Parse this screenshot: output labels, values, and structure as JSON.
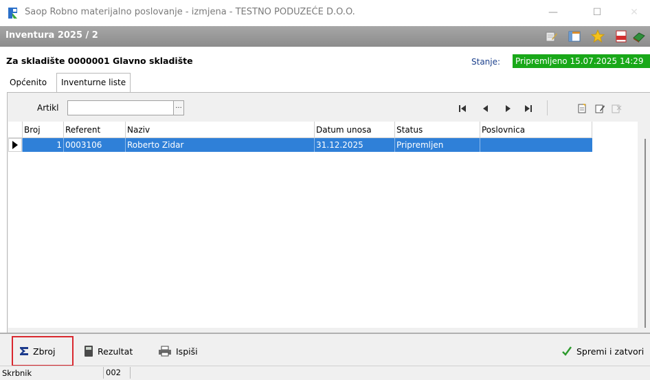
{
  "window": {
    "title": "Saop Robno materijalno poslovanje - izmjena  - TESTNO PODUZEĆE D.O.O.",
    "minimize_glyph": "—",
    "maximize_glyph": "☐",
    "close_glyph": "✕"
  },
  "form": {
    "title": "Inventura 2025 / 2",
    "warehouse": "Za skladište  0000001 Glavno skladište",
    "state_label": "Stanje:",
    "state_value": "Pripremljeno 15.07.2025 14:29"
  },
  "tabs": [
    {
      "label": "Općenito"
    },
    {
      "label": "Inventurne liste"
    }
  ],
  "toolbar": {
    "article_label": "Artikl",
    "article_value": "",
    "lookup_glyph": "..."
  },
  "grid": {
    "columns": [
      "Broj",
      "Referent",
      "Naziv",
      "Datum unosa",
      "Status",
      "Poslovnica"
    ],
    "rows": [
      {
        "broj": "1",
        "referent": "0003106",
        "naziv": "Roberto Zidar",
        "datum": "31.12.2025",
        "status": "Pripremljen",
        "poslovnica": ""
      }
    ]
  },
  "bottom": {
    "zbroj_label": "Zbroj",
    "rezultat_label": "Rezultat",
    "ispisi_label": "Ispiši",
    "save_label": "Spremi i zatvori"
  },
  "statusbar": {
    "owner_label": "Skrbnik",
    "owner_value": "002"
  },
  "colors": {
    "header_band": "#999999",
    "state_badge": "#19a819",
    "selection": "#2f80d8",
    "highlight": "#d9272e"
  },
  "icons": [
    "app-icon",
    "edit-icon",
    "layout-icon",
    "star-icon",
    "pdf-icon",
    "book-icon",
    "first-icon",
    "prev-icon",
    "next-icon",
    "last-icon",
    "new-doc-icon",
    "edit-doc-icon",
    "delete-doc-icon",
    "sigma-icon",
    "calculator-icon",
    "printer-icon",
    "checkmark-icon"
  ]
}
